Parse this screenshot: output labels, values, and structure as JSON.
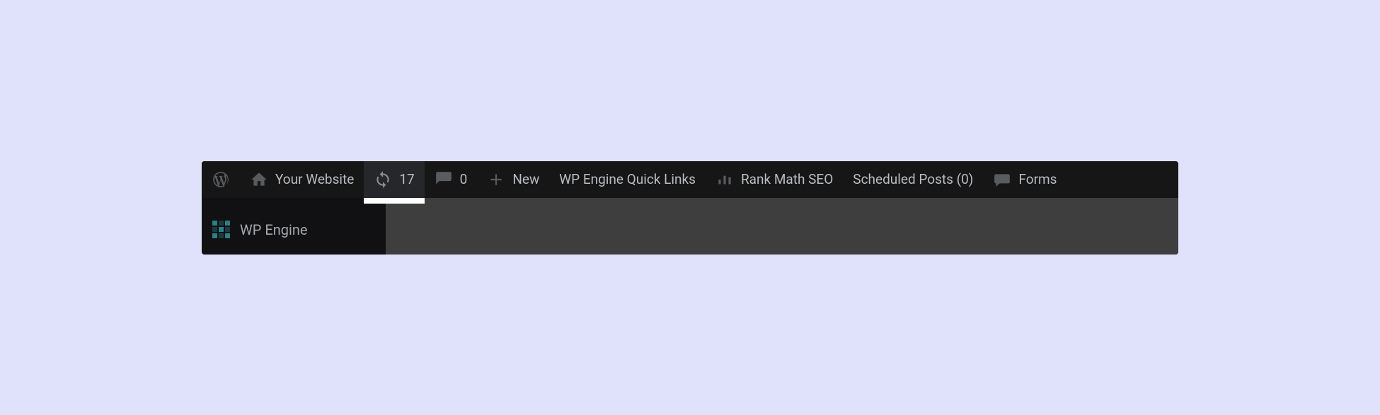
{
  "adminbar": {
    "site_name": "Your Website",
    "updates_count": "17",
    "comments_count": "0",
    "new_label": "New",
    "wp_engine_links_label": "WP Engine Quick Links",
    "rank_math_label": "Rank Math SEO",
    "scheduled_posts_label": "Scheduled Posts (0)",
    "forms_label": "Forms"
  },
  "sidebar": {
    "wp_engine_label": "WP Engine"
  }
}
